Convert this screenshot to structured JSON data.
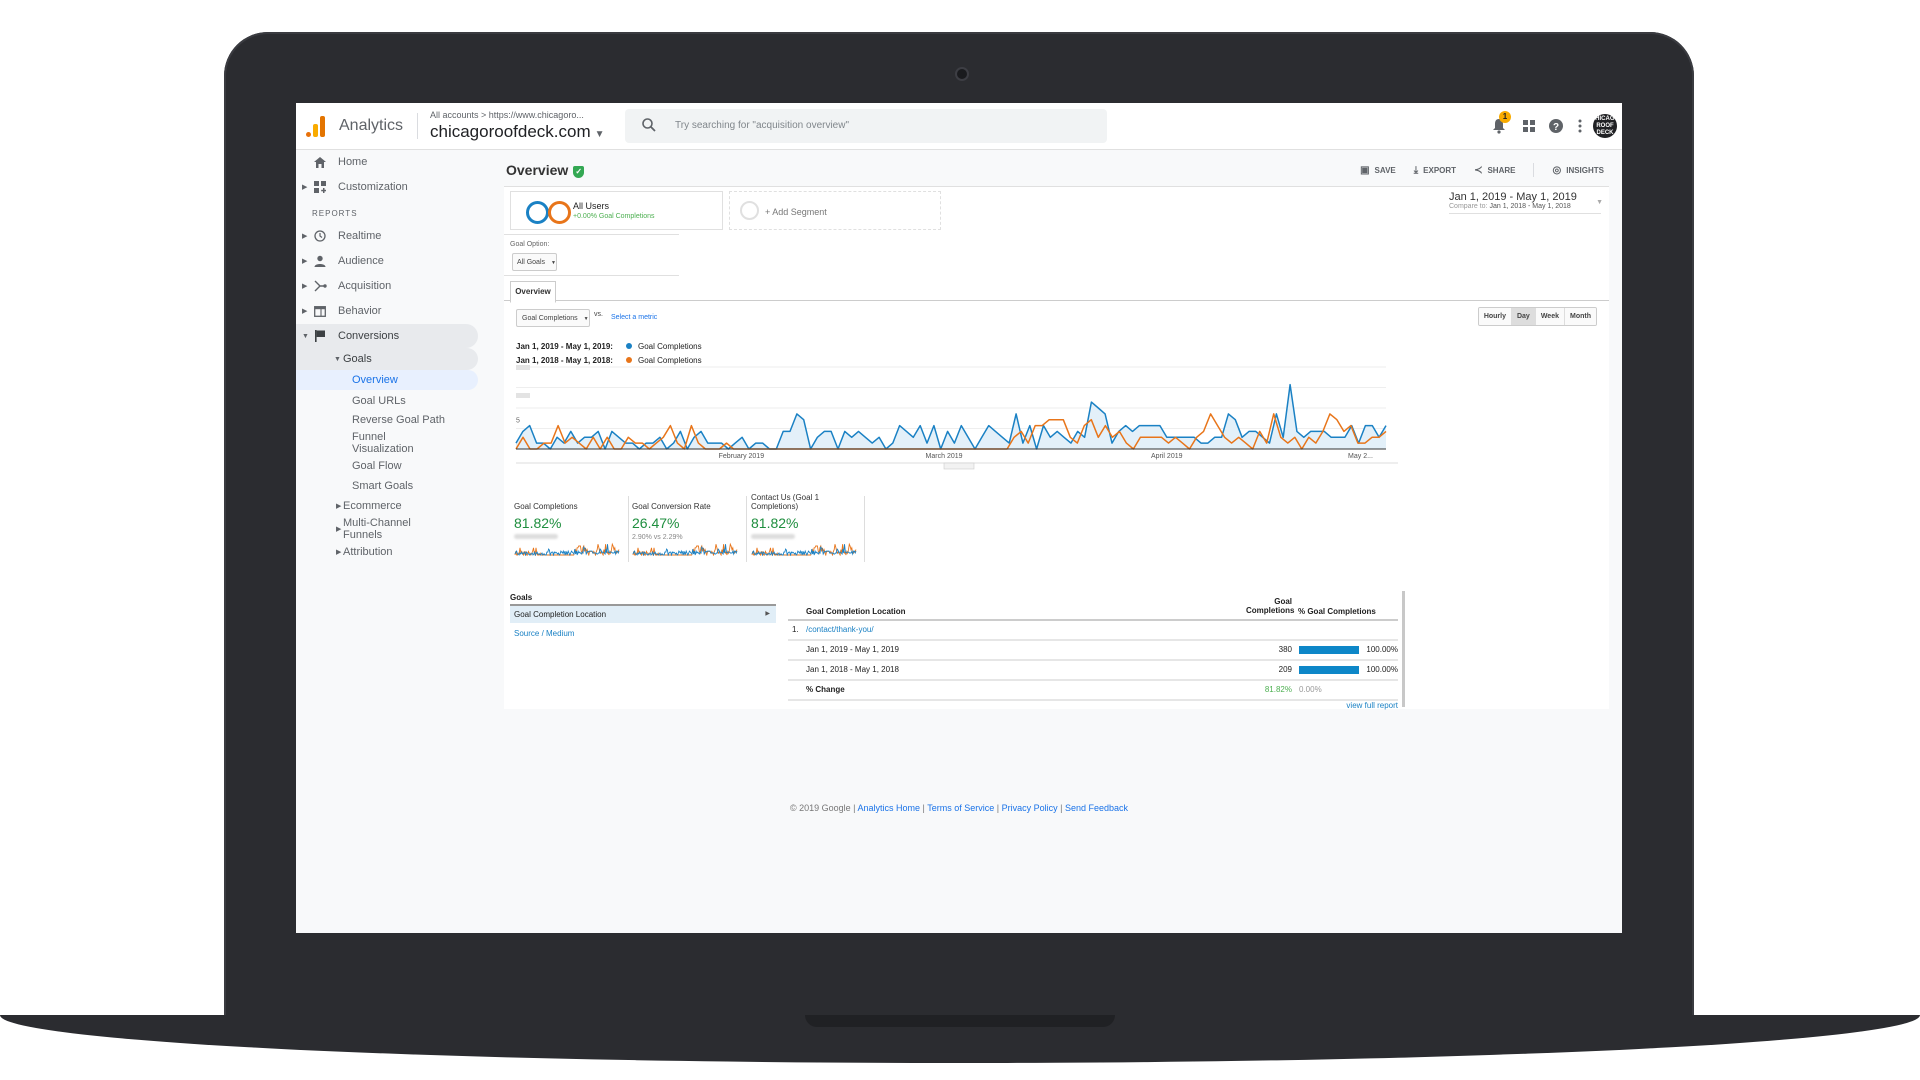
{
  "header": {
    "app_name": "Analytics",
    "breadcrumb": "All accounts > https://www.chicagoro...",
    "property": "chicagoroofdeck.com",
    "search_placeholder": "Try searching for \"acquisition overview\"",
    "notification_count": "1",
    "avatar_text": "CHICAGO ROOF DECK",
    "icons": [
      "bell-icon",
      "apps-grid-icon",
      "help-icon",
      "more-vert-icon"
    ]
  },
  "sidebar": {
    "home": "Home",
    "customization": "Customization",
    "reports_label": "REPORTS",
    "items": [
      {
        "label": "Realtime",
        "icon": "clock-icon"
      },
      {
        "label": "Audience",
        "icon": "person-icon"
      },
      {
        "label": "Acquisition",
        "icon": "acquisition-icon"
      },
      {
        "label": "Behavior",
        "icon": "behavior-icon"
      },
      {
        "label": "Conversions",
        "icon": "flag-icon"
      }
    ],
    "goals": "Goals",
    "goals_children": [
      "Overview",
      "Goal URLs",
      "Reverse Goal Path",
      "Funnel Visualization",
      "Goal Flow",
      "Smart Goals"
    ],
    "other_sections": [
      "Ecommerce",
      "Multi-Channel Funnels",
      "Attribution"
    ]
  },
  "page": {
    "title": "Overview",
    "actions": [
      "SAVE",
      "EXPORT",
      "SHARE",
      "INSIGHTS"
    ],
    "segment": {
      "name": "All Users",
      "sub": "+0.00% Goal Completions"
    },
    "add_segment": "+ Add Segment",
    "date_range": "Jan 1, 2019 - May 1, 2019",
    "compare_label": "Compare to:",
    "compare_range": "Jan 1, 2018 - May 1, 2018",
    "goal_option_label": "Goal Option:",
    "goal_option_value": "All Goals",
    "tab": "Overview",
    "metric_select": "Goal Completions",
    "vs": "vs.",
    "select_metric": "Select a metric",
    "granularity": [
      "Hourly",
      "Day",
      "Week",
      "Month"
    ],
    "granularity_selected": "Day"
  },
  "chart_data": {
    "type": "line",
    "title": "",
    "legend": [
      {
        "range": "Jan 1, 2019 - May 1, 2019:",
        "name": "Goal Completions",
        "color": "#1a81c4"
      },
      {
        "range": "Jan 1, 2018 - May 1, 2018:",
        "name": "Goal Completions",
        "color": "#e8751a"
      }
    ],
    "x_ticks": [
      "February 2019",
      "March 2019",
      "April 2019",
      "May 2..."
    ],
    "y_ticks": [
      "5"
    ],
    "ylim": [
      0,
      14
    ],
    "series": [
      {
        "name": "Jan 1, 2019 - May 1, 2019",
        "color": "#1a81c4",
        "values": [
          1,
          3,
          4,
          1,
          1,
          0,
          2,
          1,
          3,
          1,
          2,
          2,
          3,
          0,
          3,
          2,
          1,
          1,
          0,
          1,
          1,
          2,
          0,
          1,
          3,
          0,
          2,
          3,
          1,
          1,
          1,
          0,
          1,
          2,
          0,
          1,
          1,
          0,
          0,
          3,
          3,
          6,
          5,
          0,
          2,
          3,
          3,
          0,
          3,
          2,
          3,
          2,
          1,
          2,
          0,
          1,
          4,
          3,
          2,
          4,
          1,
          4,
          0,
          3,
          1,
          4,
          2,
          0,
          2,
          4,
          3,
          2,
          1,
          6,
          1,
          4,
          0,
          4,
          2,
          3,
          2,
          1,
          3,
          2,
          8,
          7,
          6,
          1,
          3,
          4,
          3,
          4,
          4,
          4,
          4,
          2,
          2,
          2,
          2,
          2,
          1,
          1,
          2,
          2,
          6,
          5,
          2,
          3,
          3,
          2,
          1,
          6,
          2,
          11,
          3,
          2,
          3,
          3,
          3,
          2,
          2,
          2,
          4,
          1,
          4,
          4,
          2,
          4
        ]
      },
      {
        "name": "Jan 1, 2018 - May 1, 2018",
        "color": "#e8751a",
        "values": [
          0,
          2,
          0,
          0,
          1,
          1,
          4,
          1,
          2,
          1,
          0,
          2,
          0,
          2,
          0,
          0,
          2,
          1,
          1,
          0,
          1,
          2,
          4,
          1,
          0,
          4,
          1,
          0,
          0,
          0,
          1,
          0,
          0,
          0,
          0,
          0,
          0,
          0,
          0,
          0,
          0,
          0,
          0,
          0,
          0,
          0,
          0,
          0,
          0,
          0,
          0,
          0,
          0,
          0,
          0,
          0,
          0,
          0,
          0,
          0,
          0,
          0,
          0,
          0,
          0,
          0,
          0,
          0,
          0,
          0,
          0,
          2,
          3,
          1,
          4,
          4,
          5,
          5,
          5,
          2,
          1,
          4,
          5,
          2,
          4,
          2,
          3,
          1,
          0,
          2,
          2,
          2,
          2,
          1,
          2,
          1,
          0,
          2,
          3,
          6,
          4,
          2,
          1,
          2,
          1,
          0,
          3,
          1,
          6,
          2,
          1,
          2,
          0,
          2,
          1,
          3,
          6,
          5,
          3,
          4,
          1,
          1,
          2,
          2,
          3
        ]
      }
    ]
  },
  "kpis": [
    {
      "name": "Goal Completions",
      "value": "81.82%",
      "sub": ""
    },
    {
      "name": "Goal Conversion Rate",
      "value": "26.47%",
      "sub": "2.90% vs 2.29%"
    },
    {
      "name": "Contact Us (Goal 1 Completions)",
      "value": "81.82%",
      "sub": ""
    }
  ],
  "goals_panel": {
    "header": "Goals",
    "items": [
      "Goal Completion Location",
      "Source / Medium"
    ]
  },
  "goals_table": {
    "columns": [
      "Goal Completion Location",
      "Goal Completions",
      "% Goal Completions"
    ],
    "row_index": "1.",
    "row_link": "/contact/thank-you/",
    "rows": [
      {
        "label": "Jan 1, 2019 - May 1, 2019",
        "value": "380",
        "pct": "100.00%",
        "bar": 1.0
      },
      {
        "label": "Jan 1, 2018 - May 1, 2018",
        "value": "209",
        "pct": "100.00%",
        "bar": 1.0
      }
    ],
    "change": {
      "label": "% Change",
      "value": "81.82%",
      "pct": "0.00%"
    },
    "view_full": "view full report"
  },
  "footer": {
    "copyright": "© 2019 Google",
    "links": [
      "Analytics Home",
      "Terms of Service",
      "Privacy Policy",
      "Send Feedback"
    ]
  }
}
